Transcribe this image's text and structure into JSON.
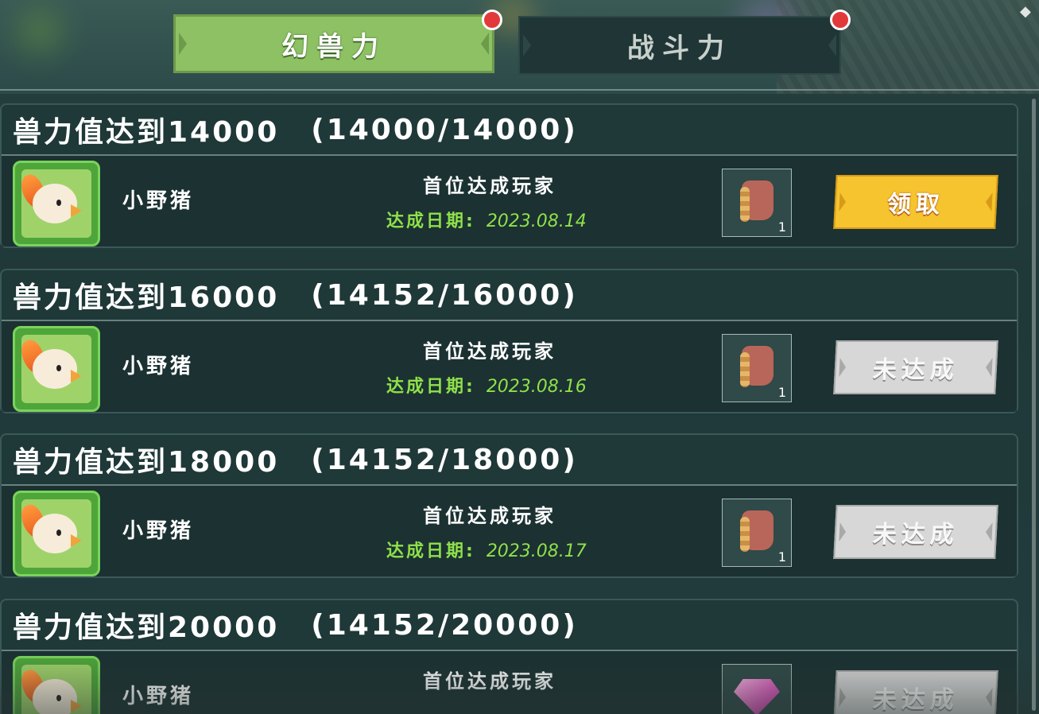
{
  "tabs": [
    {
      "label": "幻兽力",
      "active": true,
      "has_notification": true
    },
    {
      "label": "战斗力",
      "active": false,
      "has_notification": true
    }
  ],
  "colors": {
    "tab_active": "#8dc163",
    "claim_button": "#f6c42f",
    "locked_button": "#d7d7d7",
    "date_text": "#8fe04a",
    "notification_dot": "#e23a3a"
  },
  "milestones": [
    {
      "title": "兽力值达到14000",
      "progress": "(14000/14000)",
      "player_name": "小野猪",
      "first_label": "首位达成玩家",
      "date_label": "达成日期:",
      "date_value": "2023.08.14",
      "reward_icon": "leather-bag-icon",
      "reward_qty": "1",
      "button_label": "领取",
      "button_state": "claimable"
    },
    {
      "title": "兽力值达到16000",
      "progress": "(14152/16000)",
      "player_name": "小野猪",
      "first_label": "首位达成玩家",
      "date_label": "达成日期:",
      "date_value": "2023.08.16",
      "reward_icon": "leather-bag-icon",
      "reward_qty": "1",
      "button_label": "未达成",
      "button_state": "locked"
    },
    {
      "title": "兽力值达到18000",
      "progress": "(14152/18000)",
      "player_name": "小野猪",
      "first_label": "首位达成玩家",
      "date_label": "达成日期:",
      "date_value": "2023.08.17",
      "reward_icon": "leather-bag-icon",
      "reward_qty": "1",
      "button_label": "未达成",
      "button_state": "locked"
    },
    {
      "title": "兽力值达到20000",
      "progress": "(14152/20000)",
      "player_name": "小野猪",
      "first_label": "首位达成玩家",
      "date_label": "",
      "date_value": "",
      "reward_icon": "pink-gem-icon",
      "reward_qty": "",
      "button_label": "未达成",
      "button_state": "locked"
    }
  ]
}
